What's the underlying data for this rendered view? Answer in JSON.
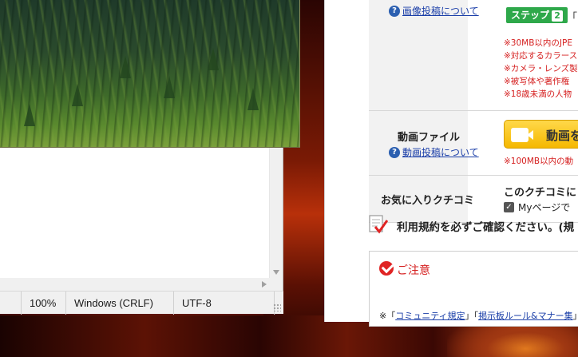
{
  "notepad": {
    "status": {
      "zoom": "100%",
      "line_ending": "Windows (CRLF)",
      "encoding": "UTF-8"
    }
  },
  "webpage": {
    "image_row": {
      "help_link": "画像投稿について",
      "step_label": "ステップ",
      "step_number": "2",
      "step_after": "「",
      "notes": [
        "※30MB以内のJPE",
        "※対応するカラース",
        "※カメラ・レンズ製品",
        "※被写体や著作権",
        "※18歳未満の人物"
      ]
    },
    "video_row": {
      "label": "動画ファイル",
      "help_link": "動画投稿について",
      "button_label": "動画を",
      "note": "※100MB以内の動"
    },
    "favorite_row": {
      "label": "お気に入りクチコミ",
      "text": "このクチコミに",
      "checkbox_label": "Myページで",
      "checked": true
    },
    "terms": {
      "text": "利用規約を必ずご確認ください。(規"
    },
    "caution": {
      "title": "ご注意",
      "body_prefix": "※「",
      "body_link1": "コミュニティ規定",
      "body_mid": "」「",
      "body_link2": "掲示板ルール&マナー集",
      "body_suffix": "」を"
    },
    "colors": {
      "step_badge": "#2ea84a",
      "note_red": "#d51f1f",
      "video_button": "#f5b800",
      "link": "#1a3ea8"
    }
  }
}
